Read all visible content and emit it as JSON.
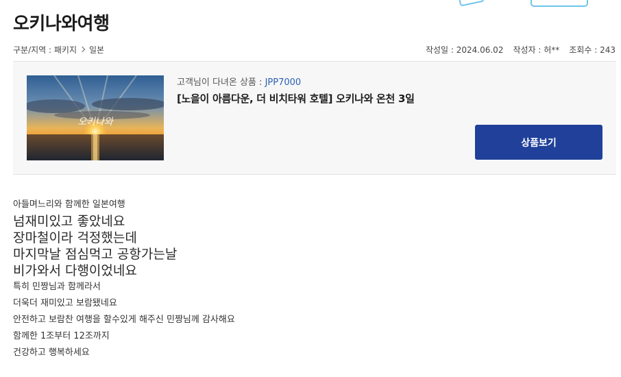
{
  "post": {
    "title": "오키나와여행",
    "breadcrumb": {
      "label": "구분/지역 : 패키지",
      "region": "일본"
    },
    "meta": {
      "date_label": "작성일 : 2024.06.02",
      "author_label": "작성자 : 허**",
      "views_label": "조회수 : 243"
    }
  },
  "product": {
    "code_prefix": "고객님이 다녀온 상품 : ",
    "code": "JPP7000",
    "name": "[노을이 아름다운, 더 비치타워 호텔] 오키나와 온천 3일",
    "button_label": "상품보기",
    "image_icon": "sunset-photo",
    "image_watermark": "오키나와"
  },
  "content": {
    "lines": [
      "아들며느리와 함께한 일본여행",
      "넘재미있고 좋았네요",
      "장마철이라 걱정했는데",
      "마지막날 점심먹고 공항가는날",
      "비가와서 다행이었네요",
      "특히 민짱님과 함께라서",
      "더욱더 재미있고 보람됐네요",
      "안전하고 보람찬 여행을 할수있게 해주신 민짱님께 감사해요",
      "함께한 1조부터 12조까지",
      "건강하고 행복하세요"
    ]
  },
  "colors": {
    "button": "#20409a",
    "code": "#2b5fb3",
    "box_bg": "#f7f7f7"
  }
}
